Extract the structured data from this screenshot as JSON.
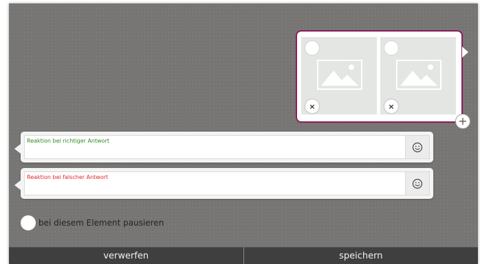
{
  "image_answers": {
    "slots": [
      {
        "remove_symbol": "×"
      },
      {
        "remove_symbol": "×"
      }
    ],
    "add_symbol": "+",
    "border_color": "#8a1c5a"
  },
  "feedback": {
    "correct": {
      "placeholder": "Reaktion bei richtiger Antwort",
      "color": "#2e8b1e",
      "icon": "smiley-icon"
    },
    "wrong": {
      "placeholder": "Reaktion bei falscher Antwort",
      "color": "#e0262b",
      "icon": "smiley-icon"
    }
  },
  "pause": {
    "label": "bei diesem Element pausieren"
  },
  "actions": {
    "discard": "verwerfen",
    "save": "speichern"
  }
}
